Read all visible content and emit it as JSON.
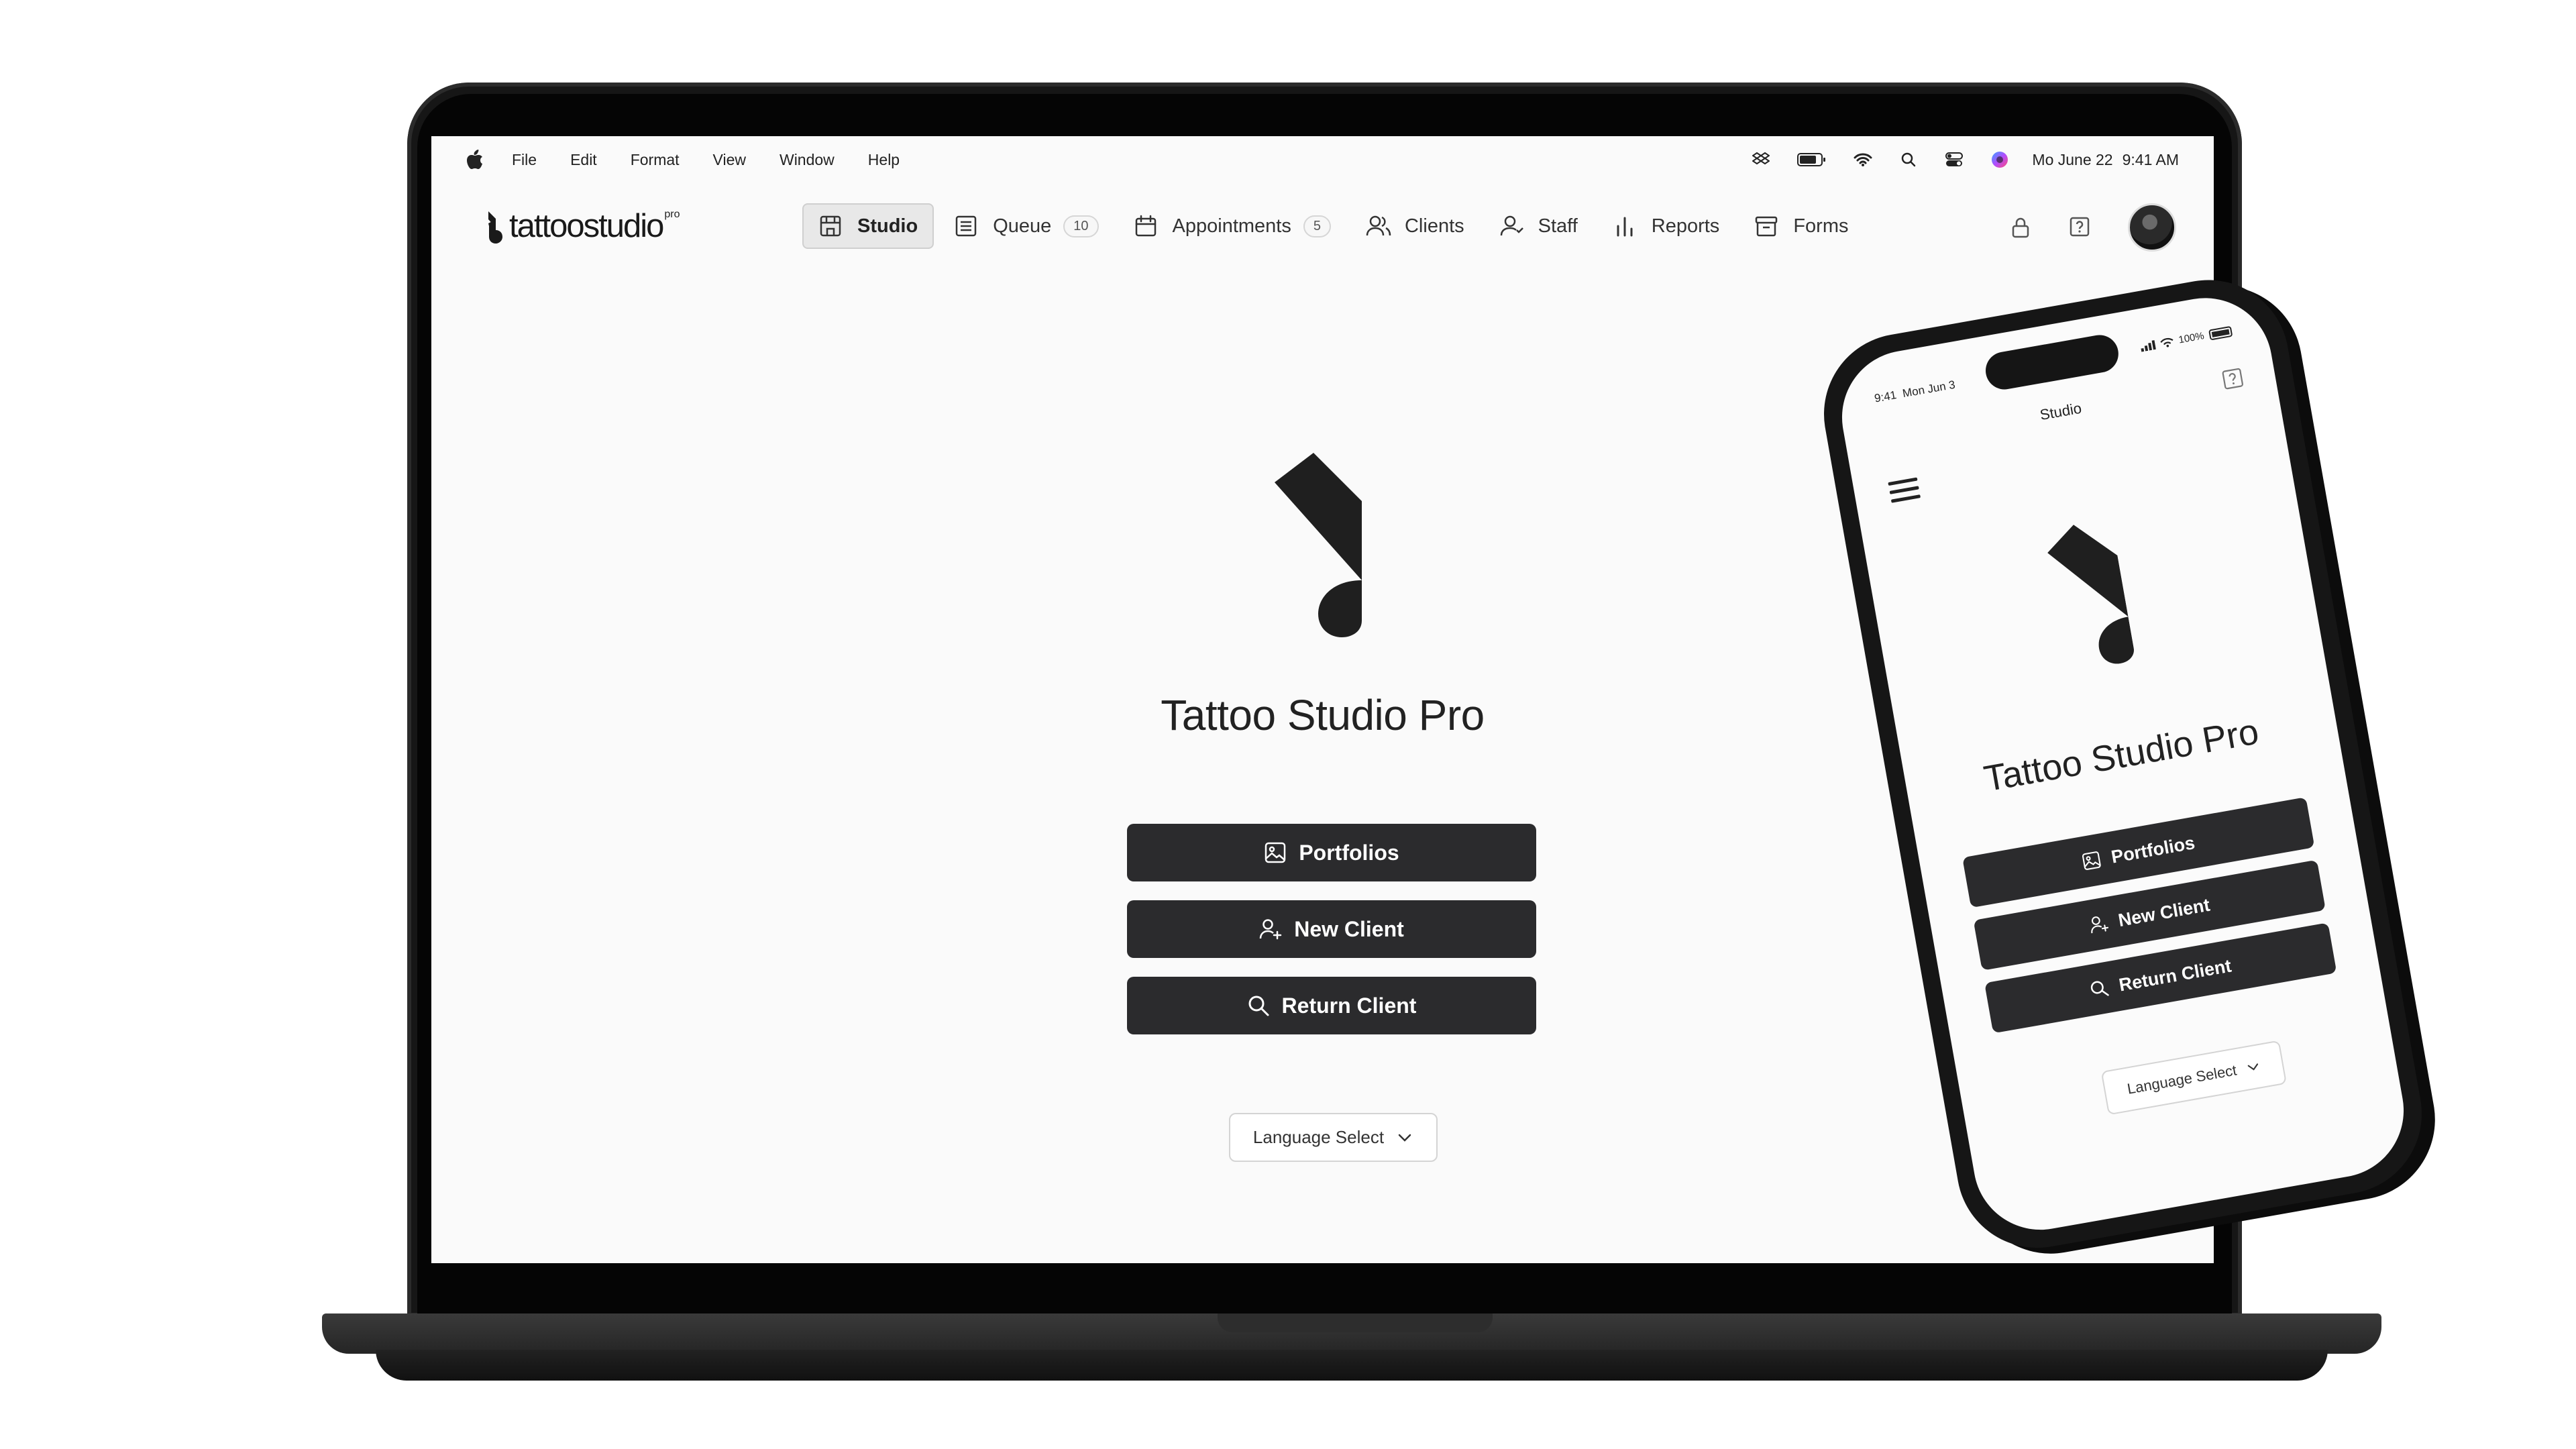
{
  "desktop": {
    "menubar": {
      "items": [
        "File",
        "Edit",
        "Format",
        "View",
        "Window",
        "Help"
      ],
      "status_icons": [
        "dropbox-icon",
        "battery-icon",
        "wifi-icon",
        "spotlight-search-icon",
        "control-center-icon",
        "siri-icon"
      ],
      "date": "Mo June 22",
      "time": "9:41 AM"
    },
    "logo": {
      "wordmark": "tattoostudio",
      "superscript": "pro"
    },
    "nav": {
      "items": [
        {
          "label": "Studio",
          "icon": "storefront-icon",
          "active": true,
          "badge": ""
        },
        {
          "label": "Queue",
          "icon": "list-icon",
          "active": false,
          "badge": "10"
        },
        {
          "label": "Appointments",
          "icon": "calendar-icon",
          "active": false,
          "badge": "5"
        },
        {
          "label": "Clients",
          "icon": "users-icon",
          "active": false,
          "badge": ""
        },
        {
          "label": "Staff",
          "icon": "staff-icon",
          "active": false,
          "badge": ""
        },
        {
          "label": "Reports",
          "icon": "bar-chart-icon",
          "active": false,
          "badge": ""
        },
        {
          "label": "Forms",
          "icon": "archive-box-icon",
          "active": false,
          "badge": ""
        }
      ],
      "right_icons": [
        "lock-icon",
        "help-icon",
        "avatar"
      ]
    },
    "main": {
      "title": "Tattoo Studio Pro",
      "buttons": {
        "portfolios": "Portfolios",
        "new_client": "New Client",
        "return_client": "Return Client"
      },
      "language_select": "Language Select"
    }
  },
  "mobile": {
    "status": {
      "time": "9:41",
      "date": "Mon Jun 3",
      "battery": "100%"
    },
    "header_title": "Studio",
    "title": "Tattoo Studio Pro",
    "buttons": {
      "portfolios": "Portfolios",
      "new_client": "New Client",
      "return_client": "Return Client"
    },
    "language_select": "Language Select"
  },
  "colors": {
    "button_bg": "#2b2b2d",
    "screen_bg": "#fafafa",
    "device_frame": "#161616"
  }
}
